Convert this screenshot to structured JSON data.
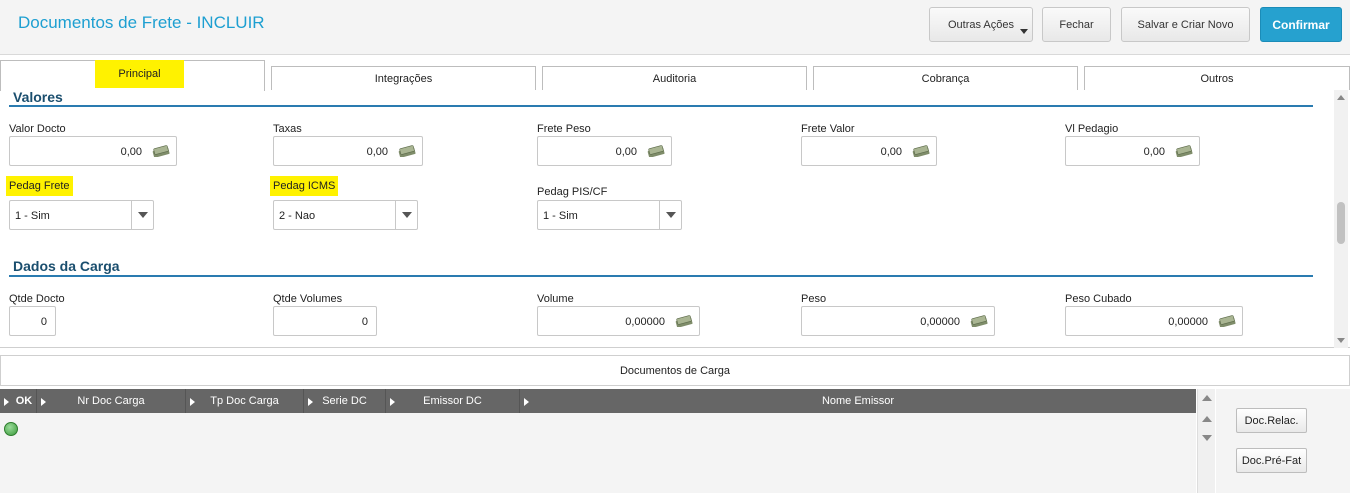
{
  "header": {
    "title": "Documentos de Frete - INCLUIR",
    "buttons": {
      "outras_acoes": "Outras Ações",
      "fechar": "Fechar",
      "salvar_criar": "Salvar e Criar Novo",
      "confirmar": "Confirmar"
    }
  },
  "tabs": [
    "Principal",
    "Integrações",
    "Auditoria",
    "Cobrança",
    "Outros"
  ],
  "valores": {
    "title": "Valores",
    "fields": [
      {
        "label": "Valor Docto",
        "value": "0,00"
      },
      {
        "label": "Taxas",
        "value": "0,00"
      },
      {
        "label": "Frete Peso",
        "value": "0,00"
      },
      {
        "label": "Frete Valor",
        "value": "0,00"
      },
      {
        "label": "Vl Pedagio",
        "value": "0,00"
      }
    ],
    "selects": [
      {
        "label": "Pedag Frete",
        "value": "1 - Sim"
      },
      {
        "label": "Pedag ICMS",
        "value": "2 - Nao"
      },
      {
        "label": "Pedag PIS/CF",
        "value": "1 - Sim"
      }
    ]
  },
  "carga": {
    "title": "Dados da Carga",
    "fields": [
      {
        "label": "Qtde Docto",
        "value": "0"
      },
      {
        "label": "Qtde Volumes",
        "value": "0"
      },
      {
        "label": "Volume",
        "value": "0,00000"
      },
      {
        "label": "Peso",
        "value": "0,00000"
      },
      {
        "label": "Peso Cubado",
        "value": "0,00000"
      }
    ]
  },
  "documentos": {
    "title": "Documentos de Carga",
    "columns": [
      "OK",
      "Nr Doc Carga",
      "Tp Doc Carga",
      "Serie DC",
      "Emissor DC",
      "Nome Emissor"
    ],
    "buttons": {
      "relac": "Doc.Relac.",
      "prefat": "Doc.Pré-Fat"
    }
  }
}
